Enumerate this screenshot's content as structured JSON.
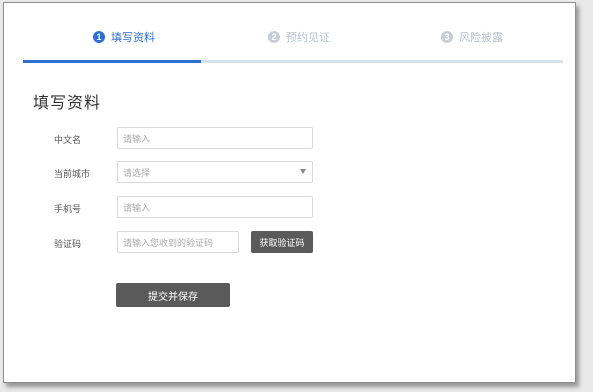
{
  "steps": [
    {
      "number": "1",
      "label": "填写资料",
      "state": "active"
    },
    {
      "number": "2",
      "label": "预约见证",
      "state": "inactive"
    },
    {
      "number": "3",
      "label": "风险披露",
      "state": "inactive"
    }
  ],
  "progress": {
    "fraction": 0.33
  },
  "form": {
    "title": "填写资料",
    "chinese_name": {
      "label": "中文名",
      "placeholder": "请输入",
      "value": ""
    },
    "city": {
      "label": "当前城市",
      "placeholder": "请选择",
      "value": ""
    },
    "phone": {
      "label": "手机号",
      "placeholder": "请输入",
      "value": ""
    },
    "code": {
      "label": "验证码",
      "placeholder": "请输入您收到的验证码",
      "value": "",
      "button_label": "获取验证码"
    },
    "submit_label": "提交并保存"
  },
  "colors": {
    "accent": "#2f6fd0",
    "inactive_step": "#c5ced9",
    "button": "#5a5a5a"
  }
}
